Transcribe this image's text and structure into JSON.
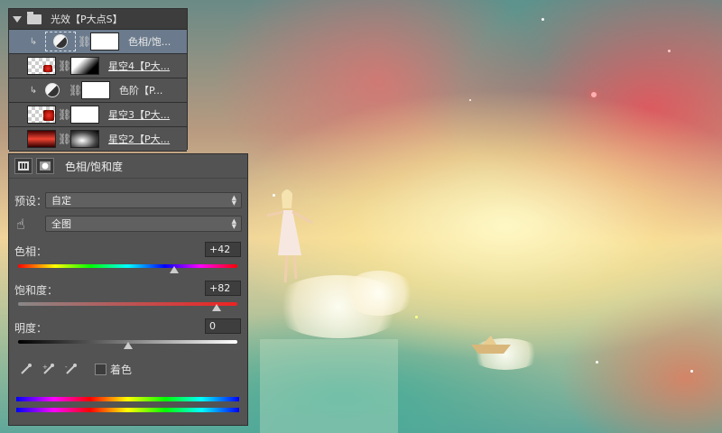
{
  "layers_panel": {
    "group": {
      "name": "光效【P大点S】"
    },
    "layers": [
      {
        "name": "色相/饱...",
        "kind": "adjustment-selected",
        "clipped": true,
        "selected": true
      },
      {
        "name": "星空4【P大...",
        "kind": "image",
        "clipped": false,
        "selected": false
      },
      {
        "name": "色阶【P...",
        "kind": "adjustment",
        "clipped": true,
        "selected": false
      },
      {
        "name": "星空3【P大...",
        "kind": "image",
        "clipped": false,
        "selected": false
      },
      {
        "name": "星空2【P大...",
        "kind": "image",
        "clipped": false,
        "selected": false
      }
    ]
  },
  "properties_panel": {
    "title": "色相/饱和度",
    "preset_label": "预设：",
    "preset_value": "自定",
    "channel_value": "全图",
    "hue": {
      "label": "色相：",
      "value": "+42",
      "position": 0.71
    },
    "saturation": {
      "label": "饱和度：",
      "value": "+82",
      "position": 0.905
    },
    "lightness": {
      "label": "明度：",
      "value": "0",
      "position": 0.5
    },
    "colorize_label": "着色",
    "colorize_checked": false
  },
  "icons": [
    "expand-triangle-icon",
    "folder-icon",
    "clip-arrow-icon",
    "adjustment-layer-icon",
    "link-chain-icon",
    "adjustment-tab-icon",
    "mask-tab-icon",
    "hand-target-icon",
    "eyedropper-icon",
    "eyedropper-plus-icon",
    "eyedropper-minus-icon"
  ],
  "colors": {
    "panel_bg": "#535353",
    "panel_dark": "#3d3d3d",
    "selection": "#6b7a8c"
  }
}
